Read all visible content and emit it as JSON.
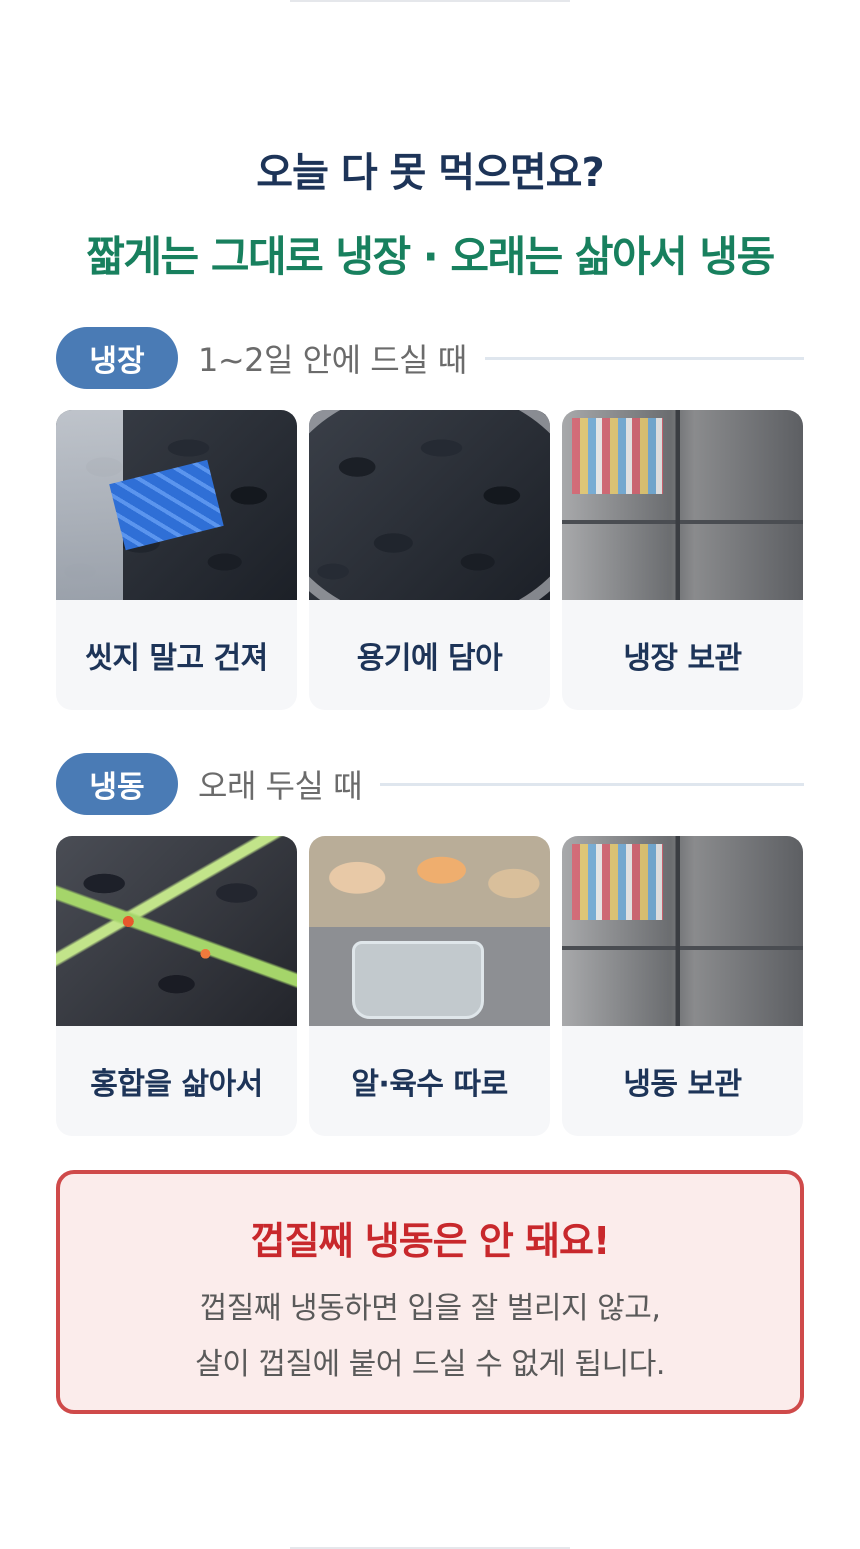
{
  "header": {
    "title": "오늘 다 못 먹으면요?",
    "subtitle": "짧게는 그대로 냉장 · 오래는 삶아서 냉동"
  },
  "fridge_section": {
    "badge": "냉장",
    "text": "1~2일 안에 드실 때",
    "cards": [
      {
        "label": "씻지 말고 건져",
        "image": "mussels-in-bag-photo"
      },
      {
        "label": "용기에 담아",
        "image": "mussels-in-bowl-photo"
      },
      {
        "label": "냉장 보관",
        "image": "refrigerator-photo"
      }
    ]
  },
  "freezer_section": {
    "badge": "냉동",
    "text": "오래 두실 때",
    "cards": [
      {
        "label": "홍합을 삶아서",
        "image": "boiled-mussels-photo"
      },
      {
        "label": "알·육수 따로",
        "image": "mussel-meat-and-broth-photo"
      },
      {
        "label": "냉동 보관",
        "image": "refrigerator-photo"
      }
    ]
  },
  "warning": {
    "title": "껍질째 냉동은 안 돼요!",
    "line1": "껍질째 냉동하면 입을 잘 벌리지 않고,",
    "line2": "살이 껍질에 붙어 드실 수 없게 됩니다."
  },
  "colors": {
    "title": "#1d3458",
    "subtitle": "#18805e",
    "badge": "#4a7bb5",
    "warning_border": "#cf4a4a",
    "warning_title": "#c8282c",
    "warning_bg": "#fbeceb"
  }
}
